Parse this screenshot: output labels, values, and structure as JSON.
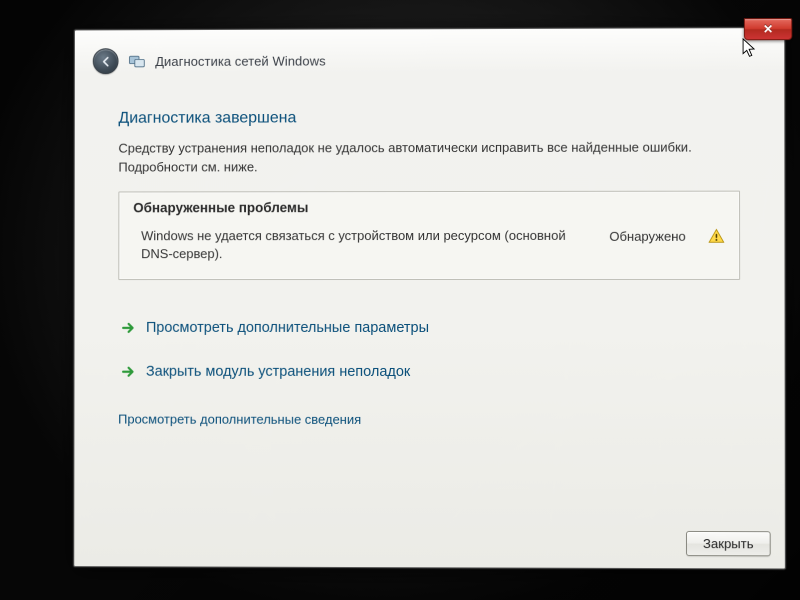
{
  "window": {
    "back_icon": "arrow-left",
    "app_icon": "network-icon",
    "title": "Диагностика сетей Windows",
    "close_label": "✕"
  },
  "main": {
    "headline": "Диагностика завершена",
    "summary": "Средству устранения неполадок не удалось автоматически исправить все найденные ошибки. Подробности см. ниже.",
    "problems": {
      "header": "Обнаруженные проблемы",
      "items": [
        {
          "desc": "Windows не удается связаться с устройством или ресурсом (основной DNS-сервер).",
          "status": "Обнаружено",
          "icon": "warning"
        }
      ]
    },
    "actions": [
      {
        "label": "Просмотреть дополнительные параметры"
      },
      {
        "label": "Закрыть модуль устранения неполадок"
      }
    ],
    "details_link": "Просмотреть дополнительные сведения"
  },
  "footer": {
    "close_label": "Закрыть"
  }
}
